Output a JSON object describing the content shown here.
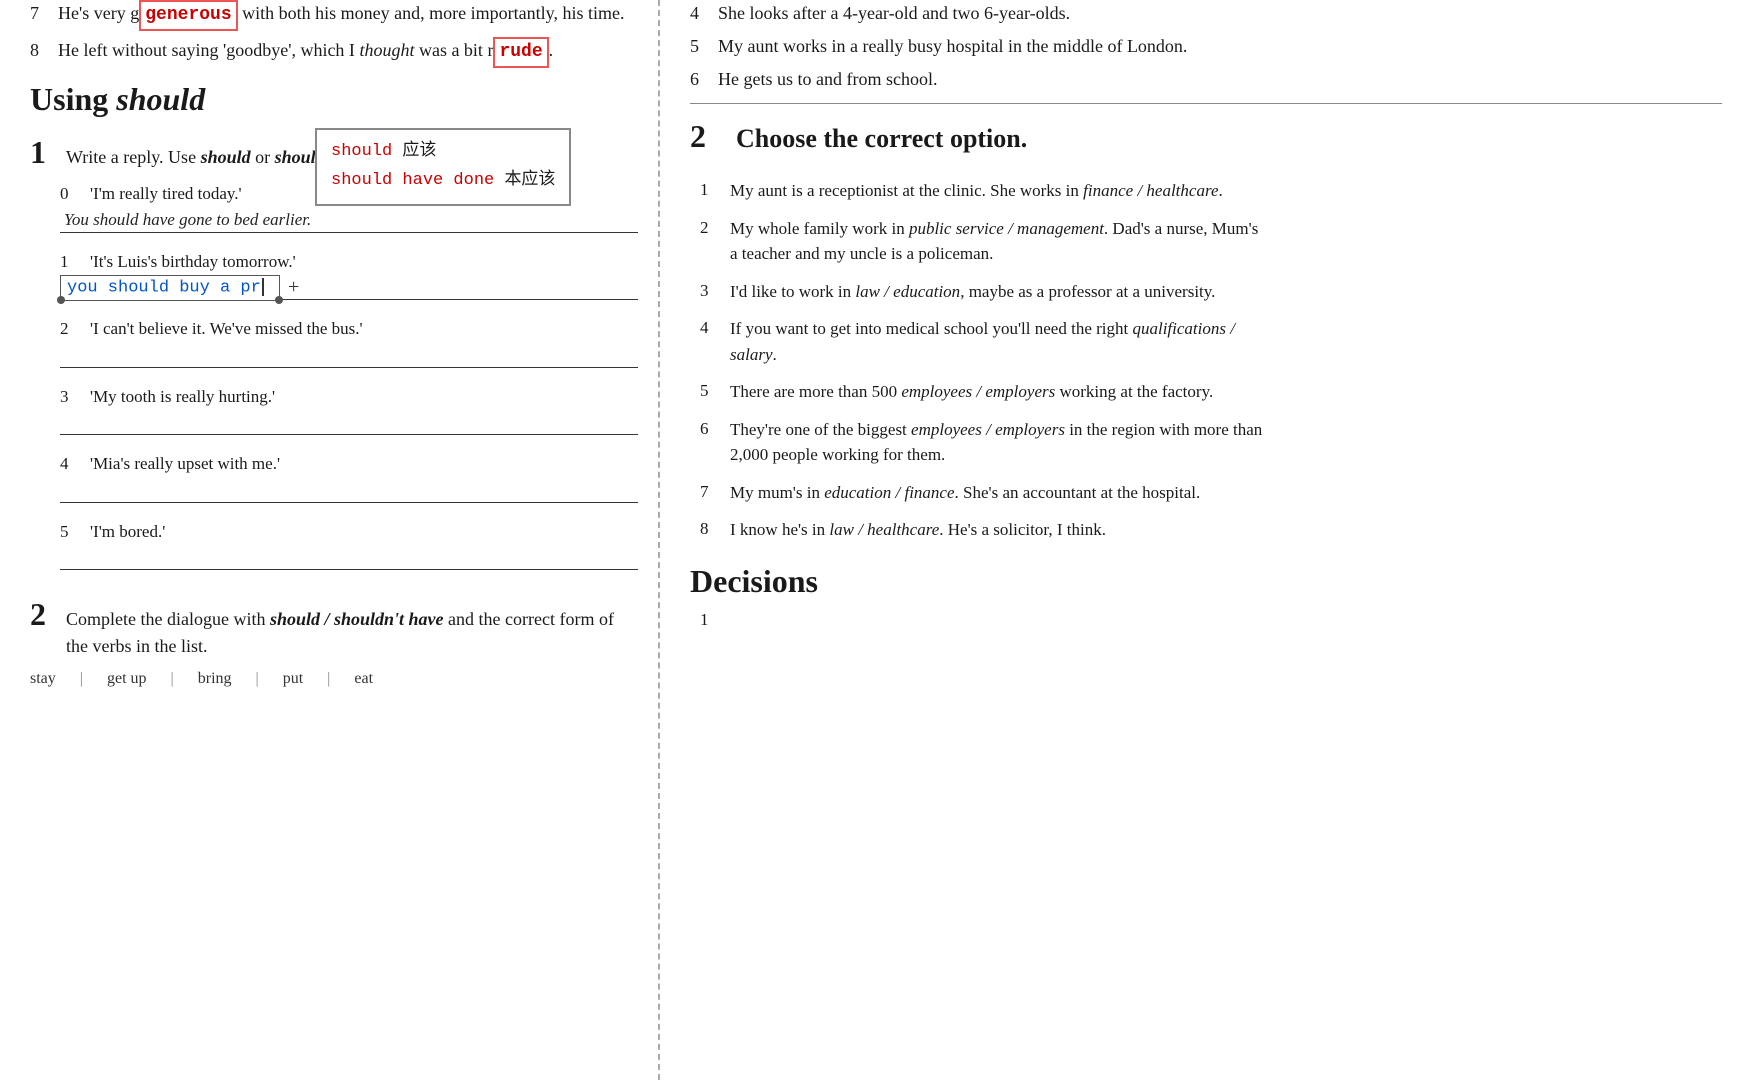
{
  "left": {
    "prev_items": [
      {
        "num": "7",
        "text": "He's very g",
        "highlight": "generous",
        "rest": " with both his money and, more importantly, his time."
      },
      {
        "num": "8",
        "text": "He left without saying 'goodbye', which I thought was a bit r",
        "highlight": "rude",
        "rest": "."
      }
    ],
    "tooltip": {
      "line1": "should  应该",
      "line2": "should have done  本应该"
    },
    "section_title_normal": "Using ",
    "section_title_italic": "should",
    "exercise1": {
      "num": "1",
      "instruction": "Write a reply. Use ",
      "instruction_em": "should",
      "instruction2": " or ",
      "instruction_em2": "shouldn't.",
      "items": [
        {
          "num": "0",
          "prompt": "'I'm really tired today.'",
          "answer": "You should have gone to bed earlier."
        },
        {
          "num": "1",
          "prompt": "'It's Luis's birthday tomorrow.'",
          "answer_typed": "you should buy a pr",
          "is_active": true
        },
        {
          "num": "2",
          "prompt": "'I can't believe it. We've missed the bus.'",
          "answer": ""
        },
        {
          "num": "3",
          "prompt": "'My tooth is really hurting.'",
          "answer": ""
        },
        {
          "num": "4",
          "prompt": "'Mia's really upset with me.'",
          "answer": ""
        },
        {
          "num": "5",
          "prompt": "'I'm bored.'",
          "answer": ""
        }
      ]
    },
    "exercise2": {
      "num": "2",
      "instruction_start": "Complete the dialogue with ",
      "instruction_em": "should / shouldn't have",
      "instruction_end": " and the correct form of the verbs in the list.",
      "verbs": [
        "stay",
        "get up",
        "bring",
        "put",
        "eat"
      ]
    }
  },
  "right": {
    "prev_items_top": [
      {
        "num": "4",
        "text": "She looks after a 4-year-old and two 6-year-olds."
      },
      {
        "num": "5",
        "text": "My aunt works in a really busy hospital in the middle of London."
      },
      {
        "num": "6",
        "text": "He gets us to and from school."
      }
    ],
    "exercise_choose": {
      "num": "2",
      "title": "Choose the correct option.",
      "items": [
        {
          "num": "1",
          "text_before": "My aunt is a receptionist at the clinic. She works in ",
          "em": "finance / healthcare",
          "text_after": "."
        },
        {
          "num": "2",
          "text_before": "My whole family work in ",
          "em": "public service / management",
          "text_after": ". Dad's a nurse, Mum's a teacher and my uncle is a policeman."
        },
        {
          "num": "3",
          "text_before": "I'd like to work in ",
          "em": "law / education",
          "text_after": ", maybe as a professor at a university."
        },
        {
          "num": "4",
          "text_before": "If you want to get into medical school you'll need the right ",
          "em": "qualifications / salary",
          "text_after": "."
        },
        {
          "num": "5",
          "text_before": "There are more than 500 ",
          "em": "employees / employers",
          "text_after": " working at the factory."
        },
        {
          "num": "6",
          "text_before": "They're one of the biggest ",
          "em": "employees / employers",
          "text_after": " in the region with more than 2,000 people working for them."
        },
        {
          "num": "7",
          "text_before": "My mum's in ",
          "em": "education / finance",
          "text_after": ". She's an accountant at the hospital."
        },
        {
          "num": "8",
          "text_before": "I know he's in ",
          "em": "law / healthcare",
          "text_after": ". He's a solicitor, I think."
        }
      ]
    },
    "decisions": {
      "title": "Decisions",
      "sub_num": "1",
      "sub_text": "..."
    }
  }
}
